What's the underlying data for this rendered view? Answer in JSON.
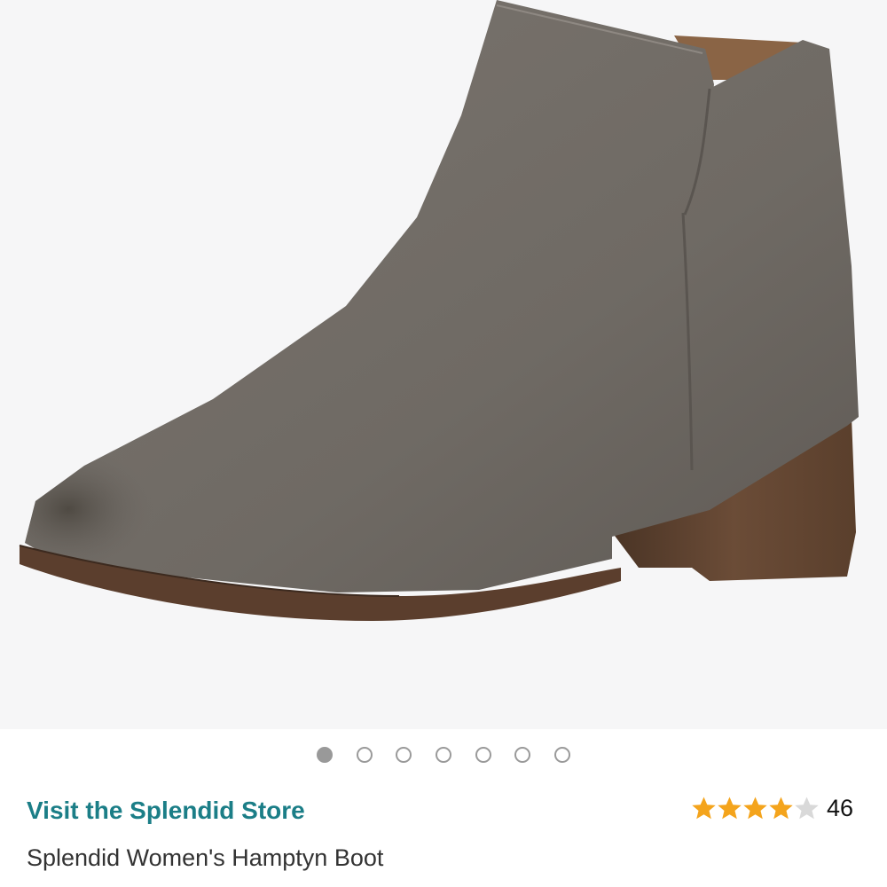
{
  "product": {
    "image_icon": "ankle-boot-photo",
    "carousel": {
      "total": 7,
      "active_index": 0
    },
    "store_link": "Visit the Splendid Store",
    "title": "Splendid Women's Hamptyn Boot",
    "rating": {
      "stars": 4,
      "max_stars": 5,
      "count": "46"
    }
  },
  "colors": {
    "link": "#1b7e87",
    "star_filled": "#f4a41c",
    "star_empty": "#d9d9d9"
  }
}
